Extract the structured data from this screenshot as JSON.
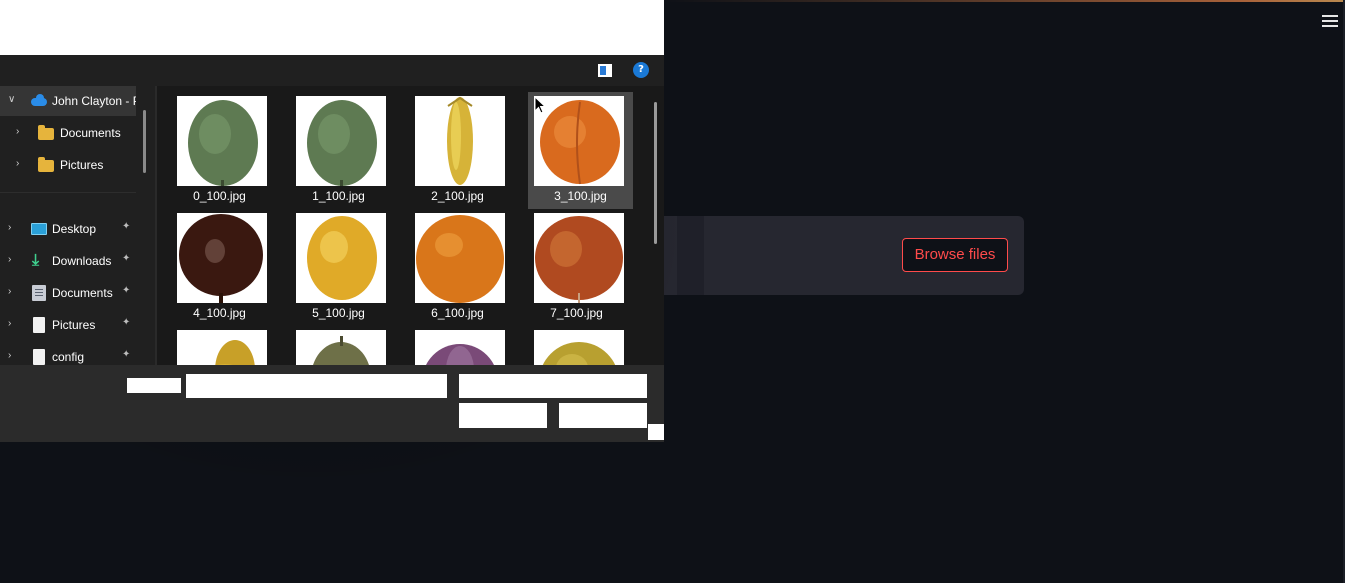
{
  "app": {
    "browse_button_label": "Browse files",
    "accent_color": "#ff4b4b",
    "menu_icon": "hamburger-icon"
  },
  "dialog": {
    "toolbar_icons": [
      "view-pane-icon",
      "help-icon"
    ],
    "nav": {
      "items": [
        {
          "label": "John Clayton - P",
          "icon": "onedrive-cloud-icon",
          "expanded": true,
          "selected": true
        },
        {
          "label": "Documents",
          "icon": "folder-icon"
        },
        {
          "label": "Pictures",
          "icon": "folder-icon"
        },
        {
          "label": "Desktop",
          "icon": "desktop-icon",
          "pinned": true
        },
        {
          "label": "Downloads",
          "icon": "download-icon",
          "pinned": true
        },
        {
          "label": "Documents",
          "icon": "documents-icon",
          "pinned": true
        },
        {
          "label": "Pictures",
          "icon": "file-icon",
          "pinned": true
        },
        {
          "label": "config",
          "icon": "file-icon",
          "pinned": true
        }
      ]
    },
    "files": [
      {
        "name": "0_100.jpg",
        "fruit": "avocado"
      },
      {
        "name": "1_100.jpg",
        "fruit": "avocado"
      },
      {
        "name": "2_100.jpg",
        "fruit": "corn"
      },
      {
        "name": "3_100.jpg",
        "fruit": "apricot",
        "selected": true
      },
      {
        "name": "4_100.jpg",
        "fruit": "dark-plum"
      },
      {
        "name": "5_100.jpg",
        "fruit": "lemon"
      },
      {
        "name": "6_100.jpg",
        "fruit": "orange"
      },
      {
        "name": "7_100.jpg",
        "fruit": "apple"
      },
      {
        "name": "",
        "fruit": "pear"
      },
      {
        "name": "",
        "fruit": "fig"
      },
      {
        "name": "",
        "fruit": "red-onion"
      },
      {
        "name": "",
        "fruit": "pear"
      }
    ]
  }
}
